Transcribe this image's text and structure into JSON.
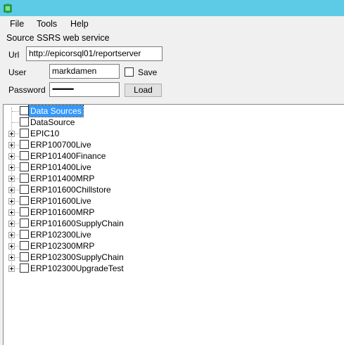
{
  "menu": {
    "file": "File",
    "tools": "Tools",
    "help": "Help"
  },
  "source": {
    "group_title": "Source SSRS web service",
    "url_label": "Url",
    "url_value": "http://epicorsql01/reportserver",
    "user_label": "User",
    "user_value": "markdamen",
    "save_label": "Save",
    "password_label": "Password",
    "password_value": "••••••••••••••••••",
    "load_label": "Load"
  },
  "tree": {
    "root_items": [
      {
        "label": "Data Sources",
        "selected": true,
        "expandable": false,
        "indent": 1
      },
      {
        "label": "DataSource",
        "selected": false,
        "expandable": false,
        "indent": 1
      }
    ],
    "items": [
      {
        "label": "EPIC10"
      },
      {
        "label": "ERP100700Live"
      },
      {
        "label": "ERP101400Finance"
      },
      {
        "label": "ERP101400Live"
      },
      {
        "label": "ERP101400MRP"
      },
      {
        "label": "ERP101600Chillstore"
      },
      {
        "label": "ERP101600Live"
      },
      {
        "label": "ERP101600MRP"
      },
      {
        "label": "ERP101600SupplyChain"
      },
      {
        "label": "ERP102300Live"
      },
      {
        "label": "ERP102300MRP"
      },
      {
        "label": "ERP102300SupplyChain"
      },
      {
        "label": "ERP102300UpgradeTest"
      }
    ]
  },
  "colors": {
    "titlebar": "#5ecbe6",
    "selection": "#3399ff"
  }
}
